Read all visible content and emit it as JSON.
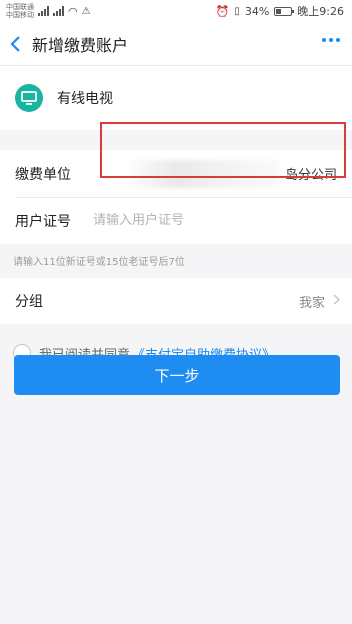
{
  "status_bar": {
    "carrier_1": "中国联通",
    "carrier_2": "中国移动",
    "battery": "34%",
    "battery_level": 0.34,
    "time": "晚上9:26"
  },
  "nav": {
    "back_icon": "chevron-left-icon",
    "title": "新增缴费账户",
    "more_icon": "more-dots-icon"
  },
  "biller": {
    "icon": "tv-icon",
    "icon_color": "#19b5a2",
    "name": "有线电视"
  },
  "form": {
    "unit_label": "缴费单位",
    "unit_value": "岛分公司",
    "id_label": "用户证号",
    "id_value": "",
    "id_placeholder": "请输入用户证号"
  },
  "hint": "请输入11位新证号或15位老证号后7位",
  "group": {
    "label": "分组",
    "value": "我家",
    "chevron_icon": "chevron-right-icon"
  },
  "agreement": {
    "text": "我已阅读并同意",
    "link": "《支付宝自助缴费协议》",
    "checked": false
  },
  "next_button": "下一步",
  "colors": {
    "accent": "#1e8cf0",
    "highlight_box": "#d93a3a"
  }
}
